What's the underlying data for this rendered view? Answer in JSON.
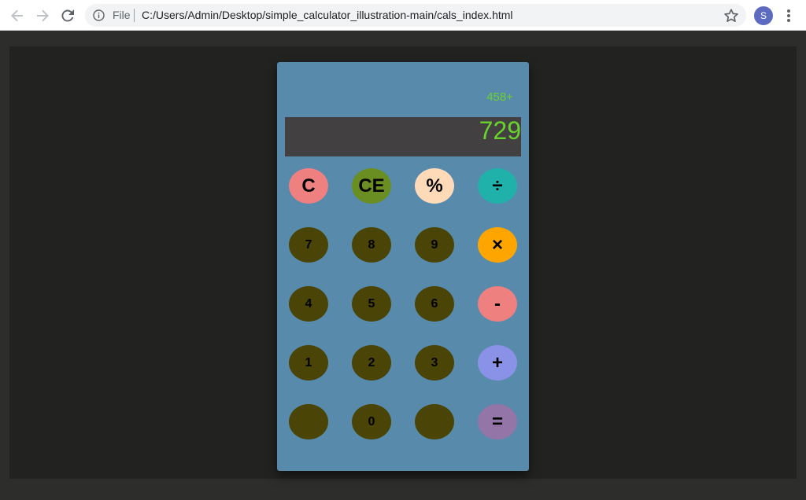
{
  "browser": {
    "scheme": "File",
    "url": "C:/Users/Admin/Desktop/simple_calculator_illustration-main/cals_index.html",
    "profile_initial": "S"
  },
  "calculator": {
    "history": "458+",
    "display": "729",
    "keys": {
      "clear": "C",
      "clear_entry": "CE",
      "percent": "%",
      "divide": "÷",
      "seven": "7",
      "eight": "8",
      "nine": "9",
      "multiply": "×",
      "four": "4",
      "five": "5",
      "six": "6",
      "minus": "-",
      "one": "1",
      "two": "2",
      "three": "3",
      "plus": "+",
      "blank_left": "",
      "zero": "0",
      "blank_right": "",
      "equals": "="
    },
    "colors": {
      "body": "#578aab",
      "display_bg": "#434041",
      "display_text": "#6ad22d",
      "number_key": "#4b4407",
      "clear": "#ee8080",
      "clear_entry": "#6b8e23",
      "percent": "#ffdab9",
      "divide": "#20b2aa",
      "multiply": "#ffa500",
      "minus": "#ee8080",
      "plus": "#8a92e8",
      "equals": "#9475a8"
    }
  }
}
